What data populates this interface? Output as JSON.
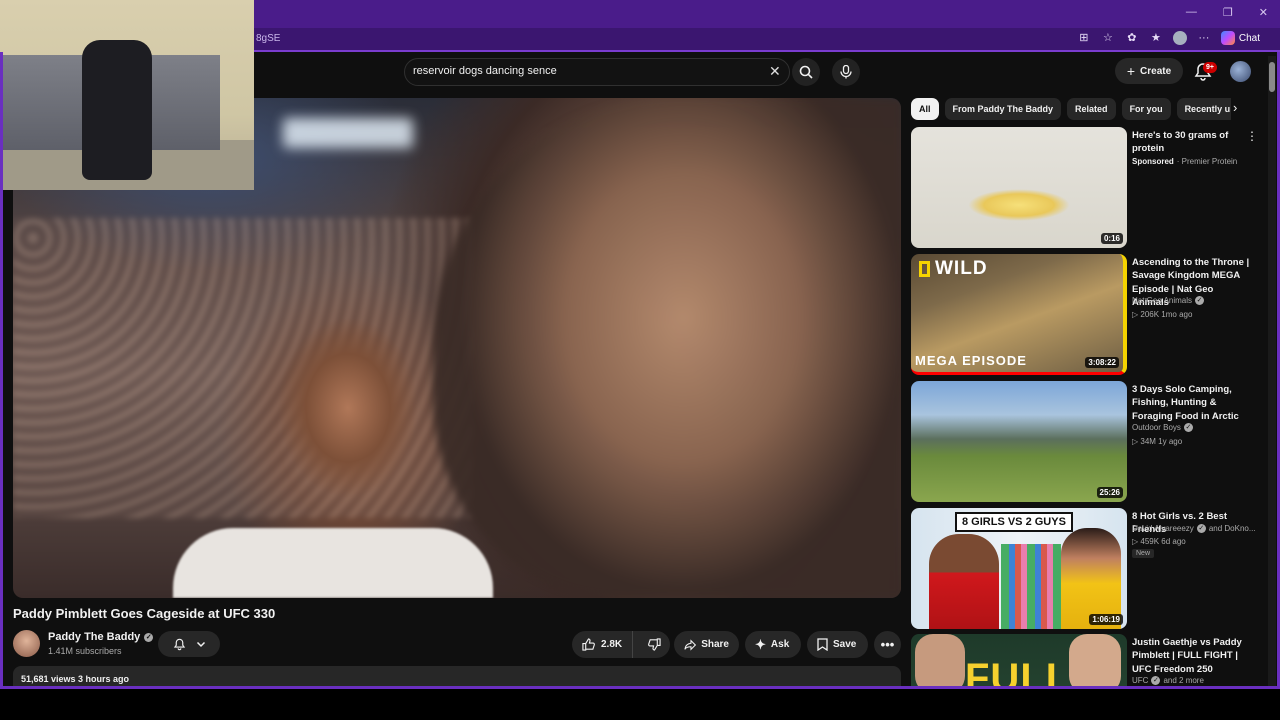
{
  "browser": {
    "url_fragment": "8gSE",
    "chat_label": "Chat"
  },
  "header": {
    "search_value": "reservoir dogs dancing sence",
    "create_label": "Create",
    "notifications_badge": "9+"
  },
  "video": {
    "title": "Paddy Pimblett Goes Cageside at UFC 330",
    "channel_name": "Paddy The Baddy",
    "subscribers": "1.41M subscribers",
    "likes": "2.8K",
    "share_label": "Share",
    "ask_label": "Ask",
    "save_label": "Save",
    "views_time": "51,681 views  3 hours ago"
  },
  "chips": [
    "All",
    "From Paddy The Baddy",
    "Related",
    "For you",
    "Recently u"
  ],
  "recommendations": [
    {
      "title": "Here's to 30 grams of protein",
      "sponsored_label": "Sponsored",
      "advertiser": " · Premier Protein",
      "duration": "0:16"
    },
    {
      "title": "Ascending to the Throne | Savage Kingdom MEGA Episode | Nat Geo Animals",
      "channel": "Nat Geo Animals",
      "meta": "▷ 206K   1mo ago",
      "duration": "3:08:22",
      "thumb_text_top": "WILD",
      "thumb_text_bottom": "MEGA EPISODE"
    },
    {
      "title": "3 Days Solo Camping, Fishing, Hunting & Foraging Food in Arctic",
      "channel": "Outdoor Boys",
      "meta": "▷ 34M   1y ago",
      "duration": "25:26"
    },
    {
      "title": "8 Hot Girls vs. 2 Best Friends",
      "channel": "David Alvareeezy",
      "channel_extra": "and DoKno...",
      "meta": "▷ 459K   6d ago",
      "badge": "New",
      "duration": "1:06:19",
      "thumb_banner": "8 GIRLS VS 2 GUYS"
    },
    {
      "title": "Justin Gaethje vs Paddy Pimblett | FULL FIGHT | UFC Freedom 250",
      "channel": "UFC",
      "channel_extra": "and 2 more",
      "thumb_text": "FULL"
    }
  ],
  "icons": {
    "search": "search-icon",
    "mic": "mic-icon",
    "bell": "bell-icon",
    "clear": "close-icon"
  },
  "colors": {
    "browser_frame": "#4a1c8a",
    "yt_background": "#0f0f0f",
    "notification_red": "#cc0000"
  }
}
